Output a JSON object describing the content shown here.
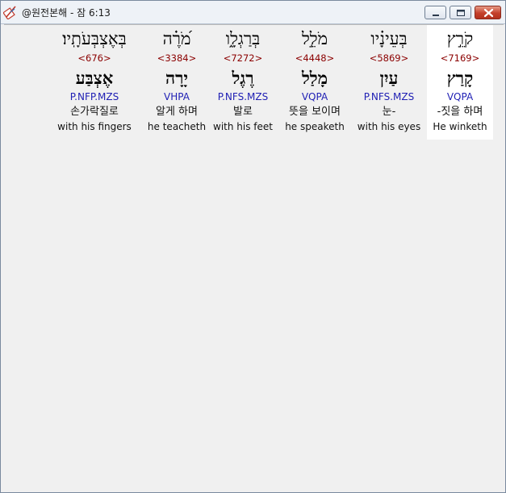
{
  "window": {
    "title": "@원전본해 - 잠 6:13",
    "app_icon": "book-feather-icon",
    "controls": {
      "minimize": "minimize-icon",
      "maximize": "maximize-icon",
      "close": "close-icon"
    }
  },
  "colors": {
    "strong_number": "#8b0000",
    "morphology": "#1f1fb4",
    "highlight": "#ffffff"
  },
  "words": [
    {
      "hebrew": "קֹרֵ֣ץ",
      "strong": "<7169>",
      "root": "קָרַץ",
      "morph": "VQPA",
      "korean": "-짓을 하며",
      "english": "He winketh",
      "selected": true
    },
    {
      "hebrew": "בְּעֵינָ֗יו",
      "strong": "<5869>",
      "root": "עַיִן",
      "morph": "P.NFS.MZS",
      "korean": "눈-",
      "english": "with his eyes",
      "selected": false
    },
    {
      "hebrew": "מֹלֵ֣ל",
      "strong": "<4448>",
      "root": "מָלַל",
      "morph": "VQPA",
      "korean": "뜻을 보이며",
      "english": "he speaketh",
      "selected": false
    },
    {
      "hebrew": "בְּרַגְלָ֑ו",
      "strong": "<7272>",
      "root": "רֶגֶל",
      "morph": "P.NFS.MZS",
      "korean": "발로",
      "english": "with his feet",
      "selected": false
    },
    {
      "hebrew": "מֹ֝רֶ֗ה",
      "strong": "<3384>",
      "root": "יָרָה",
      "morph": "VHPA",
      "korean": "알게 하며",
      "english": "he teacheth",
      "selected": false
    },
    {
      "hebrew": "בְּאֶצְבְּעֹתָֽיו׃",
      "strong": "<676>",
      "root": "אֶצְבַּע",
      "morph": "P.NFP.MZS",
      "korean": "손가락질로",
      "english": "with his fingers",
      "selected": false
    }
  ]
}
